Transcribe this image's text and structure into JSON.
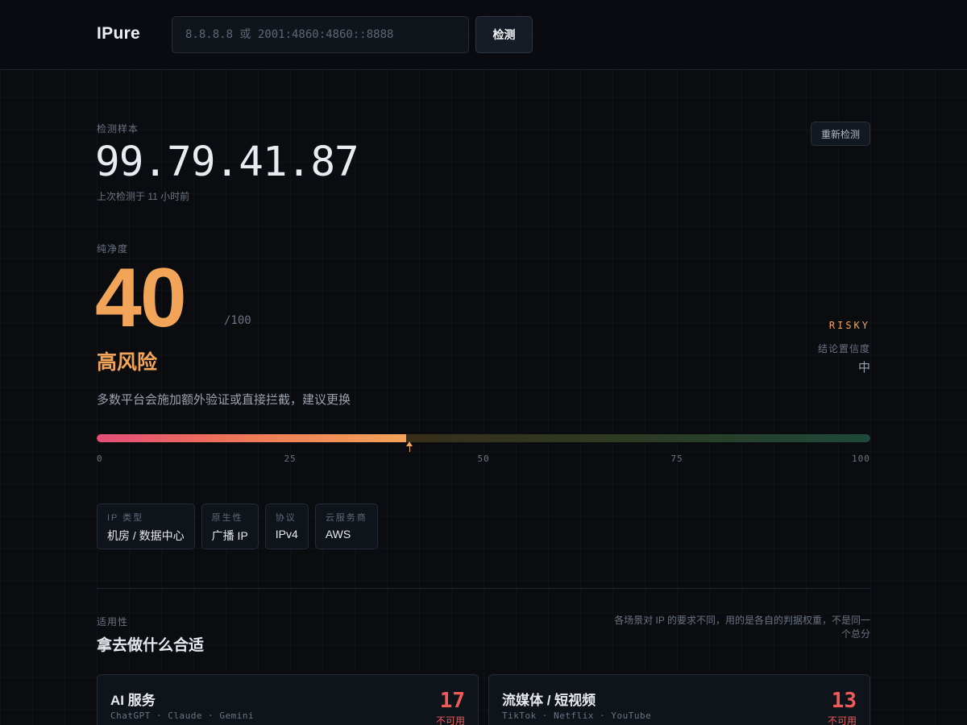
{
  "header": {
    "logo": "IPure",
    "search_placeholder": "8.8.8.8 或 2001:4860:4860::8888",
    "search_value": "",
    "detect_label": "检测"
  },
  "sample": {
    "label": "检测样本",
    "ip": "99.79.41.87",
    "last_checked": "上次检测于 11 小时前",
    "recheck_label": "重新检测"
  },
  "purity": {
    "label": "纯净度",
    "score": "40",
    "score_value": 40,
    "max": "/100",
    "level": "高风险",
    "description": "多数平台会施加额外验证或直接拦截，建议更换",
    "tag": "RISKY",
    "confidence_label": "结论置信度",
    "confidence_value": "中",
    "ticks": [
      "0",
      "25",
      "50",
      "75",
      "100"
    ],
    "color": "#f2a458"
  },
  "attributes": [
    {
      "label": "IP 类型",
      "value": "机房 / 数据中心"
    },
    {
      "label": "原生性",
      "value": "广播 IP"
    },
    {
      "label": "协议",
      "value": "IPv4"
    },
    {
      "label": "云服务商",
      "value": "AWS"
    }
  ],
  "applicability": {
    "label": "适用性",
    "title": "拿去做什么合适",
    "note": "各场景对 IP 的要求不同，用的是各自的判据权重，不是同一个总分",
    "cards": [
      {
        "title": "AI 服务",
        "subtitle": "ChatGPT · Claude · Gemini",
        "score": "17",
        "status": "不可用"
      },
      {
        "title": "流媒体 / 短视频",
        "subtitle": "TikTok · Netflix · YouTube",
        "score": "13",
        "status": "不可用"
      }
    ]
  }
}
